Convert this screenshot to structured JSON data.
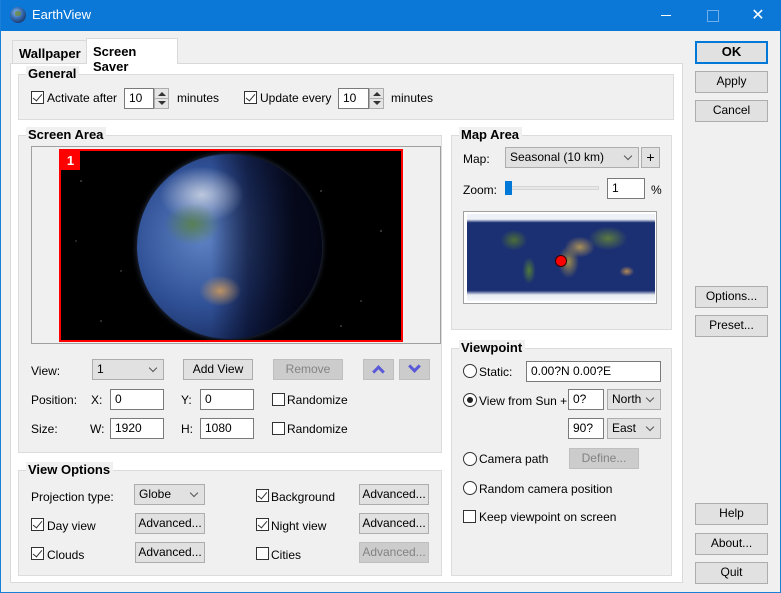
{
  "window": {
    "title": "EarthView",
    "controls": {
      "minimize": "—",
      "maximize": "☐",
      "close": "✕"
    }
  },
  "tabs": [
    {
      "label": "Wallpaper",
      "active": false
    },
    {
      "label": "Screen Saver",
      "active": true
    }
  ],
  "general": {
    "title": "General",
    "activate_after": {
      "label": "Activate after",
      "checked": true,
      "value": "10",
      "unit": "minutes"
    },
    "update_every": {
      "label": "Update every",
      "checked": true,
      "value": "10",
      "unit": "minutes"
    }
  },
  "screen_area": {
    "title": "Screen Area",
    "screen_badge": "1",
    "view_label": "View:",
    "view_value": "1",
    "add_view": "Add View",
    "remove": "Remove",
    "position_label": "Position:",
    "x_label": "X:",
    "x_value": "0",
    "y_label": "Y:",
    "y_value": "0",
    "randomize_position": {
      "label": "Randomize",
      "checked": false
    },
    "size_label": "Size:",
    "w_label": "W:",
    "w_value": "1920",
    "h_label": "H:",
    "h_value": "1080",
    "randomize_size": {
      "label": "Randomize",
      "checked": false
    }
  },
  "view_options": {
    "title": "View Options",
    "projection_label": "Projection type:",
    "projection_value": "Globe",
    "background": {
      "label": "Background",
      "checked": true,
      "advanced": "Advanced...",
      "advanced_enabled": true
    },
    "day_view": {
      "label": "Day view",
      "checked": true,
      "advanced": "Advanced...",
      "advanced_enabled": true
    },
    "night_view": {
      "label": "Night view",
      "checked": true,
      "advanced": "Advanced...",
      "advanced_enabled": true
    },
    "clouds": {
      "label": "Clouds",
      "checked": true,
      "advanced": "Advanced...",
      "advanced_enabled": true
    },
    "cities": {
      "label": "Cities",
      "checked": false,
      "advanced": "Advanced...",
      "advanced_enabled": false
    }
  },
  "map_area": {
    "title": "Map Area",
    "map_label": "Map:",
    "map_value": "Seasonal (10 km)",
    "add_map": "+",
    "zoom_label": "Zoom:",
    "zoom_value": "1",
    "zoom_unit": "%",
    "zoom_slider_fraction": 0.01
  },
  "viewpoint": {
    "title": "Viewpoint",
    "static": {
      "label": "Static:",
      "selected": false,
      "value": "0.00?N   0.00?E"
    },
    "view_from_sun": {
      "label": "View from Sun +",
      "selected": true,
      "lat_value": "0?",
      "lat_dir": "North",
      "lon_value": "90?",
      "lon_dir": "East"
    },
    "camera_path": {
      "label": "Camera path",
      "selected": false,
      "define": "Define..."
    },
    "random_camera": {
      "label": "Random camera position",
      "selected": false
    },
    "keep_on_screen": {
      "label": "Keep viewpoint on screen",
      "checked": false
    }
  },
  "side_buttons": {
    "ok": "OK",
    "apply": "Apply",
    "cancel": "Cancel",
    "options": "Options...",
    "preset": "Preset...",
    "help": "Help",
    "about": "About...",
    "quit": "Quit"
  }
}
